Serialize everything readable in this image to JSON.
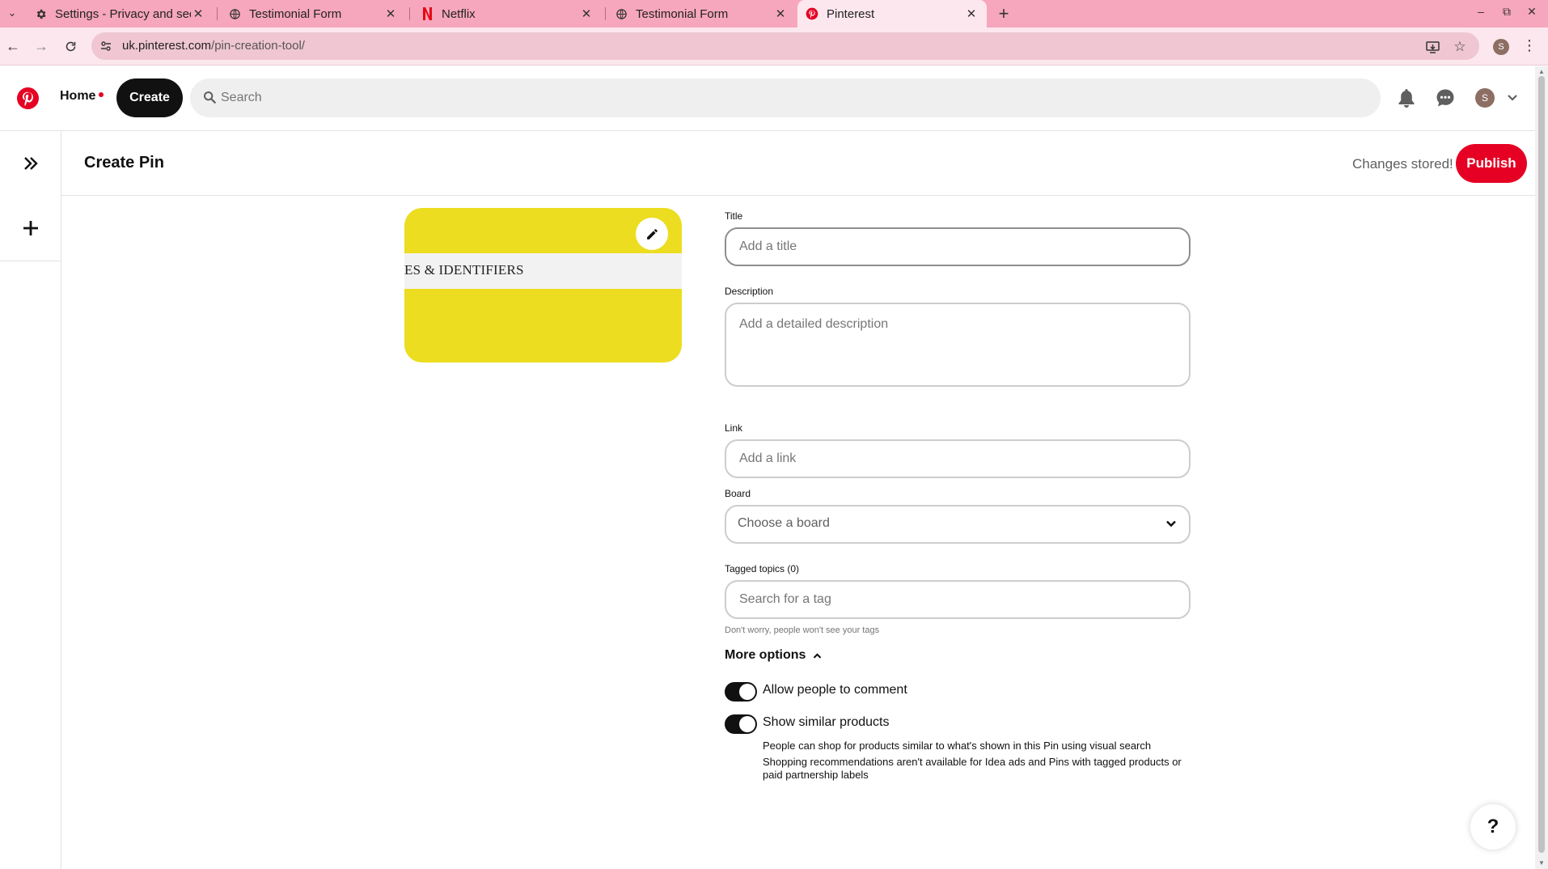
{
  "browser": {
    "tabs": [
      {
        "title": "Settings - Privacy and security",
        "icon": "gear-icon",
        "active": false
      },
      {
        "title": "Testimonial Form",
        "icon": "globe-icon",
        "active": false
      },
      {
        "title": "Netflix",
        "icon": "netflix-icon",
        "active": false
      },
      {
        "title": "Testimonial Form",
        "icon": "globe-icon",
        "active": false
      },
      {
        "title": "Pinterest",
        "icon": "pinterest-icon",
        "active": true
      }
    ],
    "url_host": "uk.pinterest.com",
    "url_path": "/pin-creation-tool/",
    "profile_initial": "S",
    "tab_strip_color": "#f6a6bd",
    "toolbar_color": "#fde7ee"
  },
  "header": {
    "home_label": "Home",
    "create_label": "Create",
    "search_placeholder": "Search",
    "avatar_initial": "S"
  },
  "page": {
    "title": "Create Pin",
    "status": "Changes stored!",
    "publish_label": "Publish"
  },
  "pin_image": {
    "caption": "ES & IDENTIFIERS",
    "background_color": "#ecdd20"
  },
  "form": {
    "title_label": "Title",
    "title_placeholder": "Add a title",
    "description_label": "Description",
    "description_placeholder": "Add a detailed description",
    "link_label": "Link",
    "link_placeholder": "Add a link",
    "board_label": "Board",
    "board_value": "Choose a board",
    "topics_label": "Tagged topics (0)",
    "topics_placeholder": "Search for a tag",
    "topics_hint": "Don't worry, people won't see your tags",
    "more_options_label": "More options",
    "allow_comments_label": "Allow people to comment",
    "allow_comments_on": true,
    "similar_products_label": "Show similar products",
    "similar_products_on": true,
    "similar_products_sub1": "People can shop for products similar to what's shown in this Pin using visual search",
    "similar_products_sub2": "Shopping recommendations aren't available for Idea ads and Pins with tagged products or paid partnership labels"
  },
  "colors": {
    "brand_red": "#e60023",
    "dark": "#111111"
  },
  "help_label": "?"
}
